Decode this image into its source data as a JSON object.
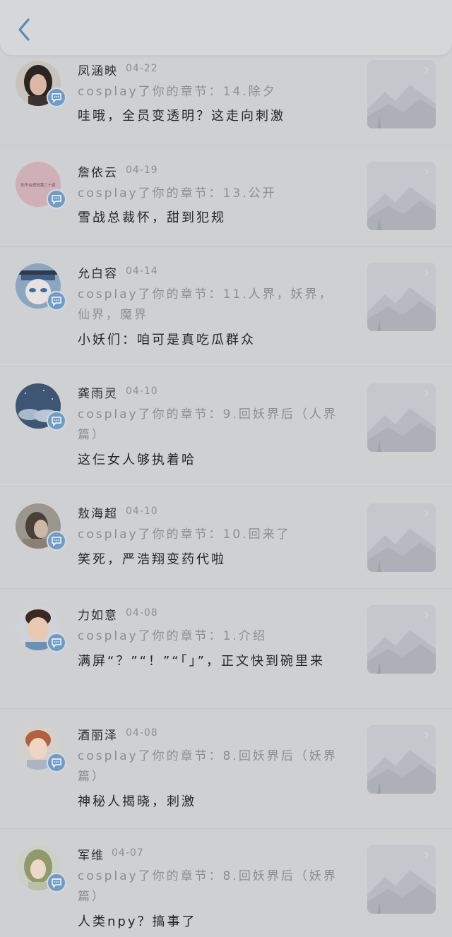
{
  "nav": {
    "back_icon": "chevron-left-icon",
    "accent": "#5b87b4"
  },
  "items": [
    {
      "name": "凤涵映",
      "date": "04-22",
      "action": "cosplay了你的章节：14.除夕",
      "comment": "哇哦，全员变透明？这走向刺激"
    },
    {
      "name": "詹依云",
      "date": "04-19",
      "action": "cosplay了你的章节：13.公开",
      "comment": "雪战总裁怀，甜到犯规",
      "avatar_text": "你不会感觉我二十疯"
    },
    {
      "name": "允白容",
      "date": "04-14",
      "action": "cosplay了你的章节：11.人界，妖界，仙界，魔界",
      "comment": "小妖们：咱可是真吃瓜群众"
    },
    {
      "name": "龚雨灵",
      "date": "04-10",
      "action": "cosplay了你的章节：9.回妖界后（人界篇）",
      "comment": "这仨女人够执着哈"
    },
    {
      "name": "敖海超",
      "date": "04-10",
      "action": "cosplay了你的章节：10.回来了",
      "comment": "笑死，严浩翔变药代啦"
    },
    {
      "name": "力如意",
      "date": "04-08",
      "action": "cosplay了你的章节：1.介绍",
      "comment": "满屏“？”“！”“「」”，正文快到碗里来"
    },
    {
      "name": "酒丽泽",
      "date": "04-08",
      "action": "cosplay了你的章节：8.回妖界后（妖界篇）",
      "comment": "神秘人揭晓，刺激"
    },
    {
      "name": "军维",
      "date": "04-07",
      "action": "cosplay了你的章节：8.回妖界后（妖界篇）",
      "comment": "人类npy？搞事了"
    }
  ]
}
